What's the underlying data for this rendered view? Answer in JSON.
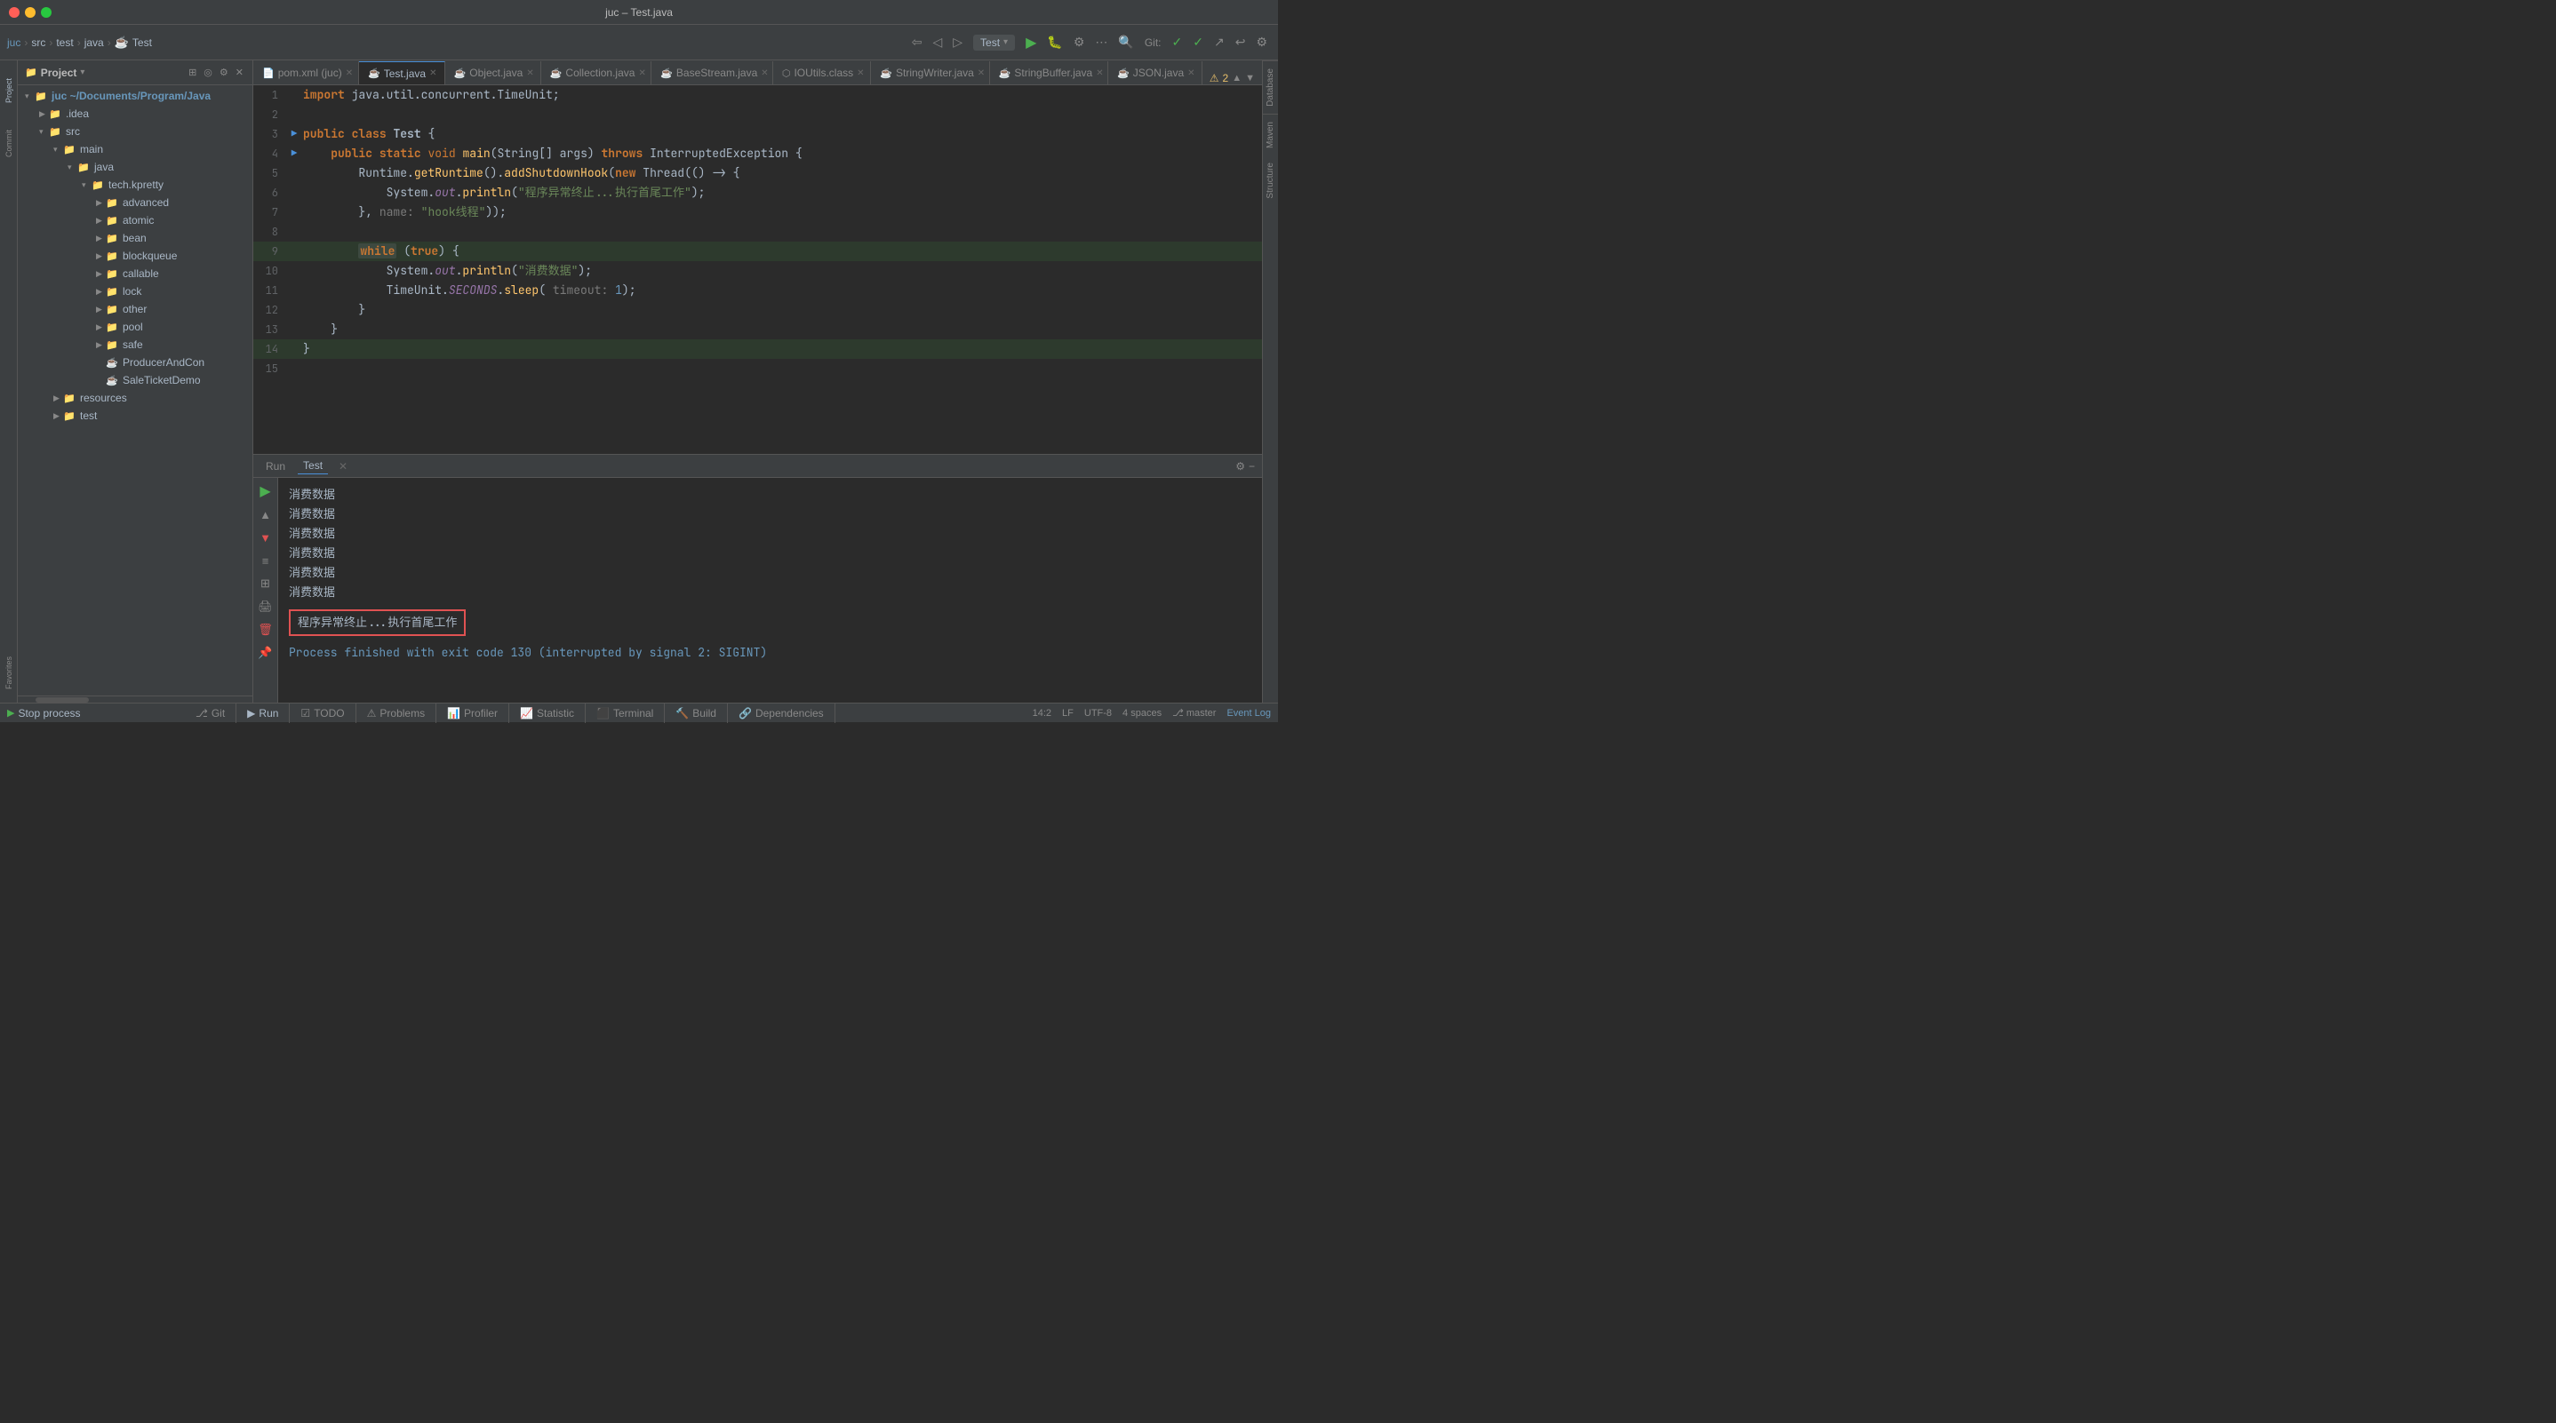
{
  "titleBar": {
    "title": "juc – Test.java",
    "controls": [
      "close",
      "minimize",
      "maximize"
    ]
  },
  "breadcrumb": {
    "items": [
      "juc",
      "src",
      "test",
      "java",
      "Test"
    ]
  },
  "topToolbar": {
    "run_config": "Test",
    "git_label": "Git:"
  },
  "fileTree": {
    "panelTitle": "Project",
    "root": {
      "name": "juc ~/Documents/Program/Java",
      "children": [
        {
          "name": ".idea",
          "type": "folder",
          "level": 1
        },
        {
          "name": "src",
          "type": "folder",
          "level": 1,
          "expanded": true,
          "children": [
            {
              "name": "main",
              "type": "folder",
              "level": 2,
              "expanded": true,
              "children": [
                {
                  "name": "java",
                  "type": "folder",
                  "level": 3,
                  "expanded": true,
                  "children": [
                    {
                      "name": "tech.kpretty",
                      "type": "folder",
                      "level": 4,
                      "expanded": true,
                      "children": [
                        {
                          "name": "advanced",
                          "type": "folder",
                          "level": 5
                        },
                        {
                          "name": "atomic",
                          "type": "folder",
                          "level": 5
                        },
                        {
                          "name": "bean",
                          "type": "folder",
                          "level": 5
                        },
                        {
                          "name": "blockqueue",
                          "type": "folder",
                          "level": 5
                        },
                        {
                          "name": "callable",
                          "type": "folder",
                          "level": 5
                        },
                        {
                          "name": "lock",
                          "type": "folder",
                          "level": 5
                        },
                        {
                          "name": "other",
                          "type": "folder",
                          "level": 5
                        },
                        {
                          "name": "pool",
                          "type": "folder",
                          "level": 5
                        },
                        {
                          "name": "safe",
                          "type": "folder",
                          "level": 5
                        },
                        {
                          "name": "ProducerAndCon",
                          "type": "java",
                          "level": 5
                        },
                        {
                          "name": "SaleTicketDemo",
                          "type": "java",
                          "level": 5
                        }
                      ]
                    }
                  ]
                }
              ]
            },
            {
              "name": "resources",
              "type": "folder",
              "level": 2
            },
            {
              "name": "test",
              "type": "folder",
              "level": 2
            }
          ]
        }
      ]
    }
  },
  "tabs": [
    {
      "name": "pom.xml (juc)",
      "icon": "xml",
      "active": false,
      "modified": false
    },
    {
      "name": "Test.java",
      "icon": "java",
      "active": true,
      "modified": false
    },
    {
      "name": "Object.java",
      "icon": "java",
      "active": false,
      "modified": false
    },
    {
      "name": "Collection.java",
      "icon": "java",
      "active": false,
      "modified": false
    },
    {
      "name": "BaseStream.java",
      "icon": "java",
      "active": false,
      "modified": false
    },
    {
      "name": "IOUtils.class",
      "icon": "class",
      "active": false,
      "modified": false
    },
    {
      "name": "StringWriter.java",
      "icon": "java",
      "active": false,
      "modified": false
    },
    {
      "name": "StringBuffer.java",
      "icon": "java",
      "active": false,
      "modified": false
    },
    {
      "name": "JSON.java",
      "icon": "java",
      "active": false,
      "modified": false
    }
  ],
  "codeLines": [
    {
      "num": 1,
      "content": "import java.util.concurrent.TimeUnit;",
      "arrow": "",
      "highlighted": false
    },
    {
      "num": 2,
      "content": "",
      "arrow": "",
      "highlighted": false
    },
    {
      "num": 3,
      "content": "public class Test {",
      "arrow": "▶",
      "highlighted": false
    },
    {
      "num": 4,
      "content": "    public static void main(String[] args) throws InterruptedException {",
      "arrow": "▶",
      "highlighted": false
    },
    {
      "num": 5,
      "content": "        Runtime.getRuntime().addShutdownHook(new Thread(() -> {",
      "arrow": "",
      "highlighted": false
    },
    {
      "num": 6,
      "content": "            System.out.println(\"程序异常终止...执行首尾工作\");",
      "arrow": "",
      "highlighted": false
    },
    {
      "num": 7,
      "content": "        }, name: \"hook线程\"));",
      "arrow": "",
      "highlighted": false
    },
    {
      "num": 8,
      "content": "",
      "arrow": "",
      "highlighted": false
    },
    {
      "num": 9,
      "content": "        while (true) {",
      "arrow": "",
      "highlighted": true
    },
    {
      "num": 10,
      "content": "            System.out.println(\"消费数据\");",
      "arrow": "",
      "highlighted": false
    },
    {
      "num": 11,
      "content": "            TimeUnit.SECONDS.sleep( timeout: 1);",
      "arrow": "",
      "highlighted": false
    },
    {
      "num": 12,
      "content": "        }",
      "arrow": "",
      "highlighted": false
    },
    {
      "num": 13,
      "content": "    }",
      "arrow": "",
      "highlighted": false
    },
    {
      "num": 14,
      "content": "}",
      "arrow": "",
      "highlighted": true
    },
    {
      "num": 15,
      "content": "",
      "arrow": "",
      "highlighted": false
    }
  ],
  "runPanel": {
    "tabs": [
      "Run",
      "Test"
    ],
    "activeTab": "Test",
    "consoleLines": [
      "消费数据",
      "消费数据",
      "消费数据",
      "消费数据",
      "消费数据",
      "消费数据"
    ],
    "highlightedLine": "程序异常终止...执行首尾工作",
    "processLine": "Process finished with exit code 130 (interrupted by signal 2: SIGINT)"
  },
  "statusBar": {
    "stopProcess": "Stop process",
    "tabs": [
      {
        "label": "Git",
        "icon": "git"
      },
      {
        "label": "Run",
        "icon": "run"
      },
      {
        "label": "TODO",
        "icon": "todo"
      },
      {
        "label": "Problems",
        "icon": "problems"
      },
      {
        "label": "Profiler",
        "icon": "profiler"
      },
      {
        "label": "Statistic",
        "icon": "statistic"
      },
      {
        "label": "Terminal",
        "icon": "terminal"
      },
      {
        "label": "Build",
        "icon": "build"
      },
      {
        "label": "Dependencies",
        "icon": "deps"
      }
    ],
    "rightItems": {
      "position": "14:2",
      "encoding": "LF",
      "charset": "UTF-8",
      "indent": "4 spaces",
      "branch": "master",
      "eventLog": "Event Log"
    }
  },
  "sidebarPanels": {
    "left": [
      "Project",
      "Commit",
      "Favorites"
    ],
    "right": [
      "Database",
      "Maven",
      "Structure"
    ]
  }
}
